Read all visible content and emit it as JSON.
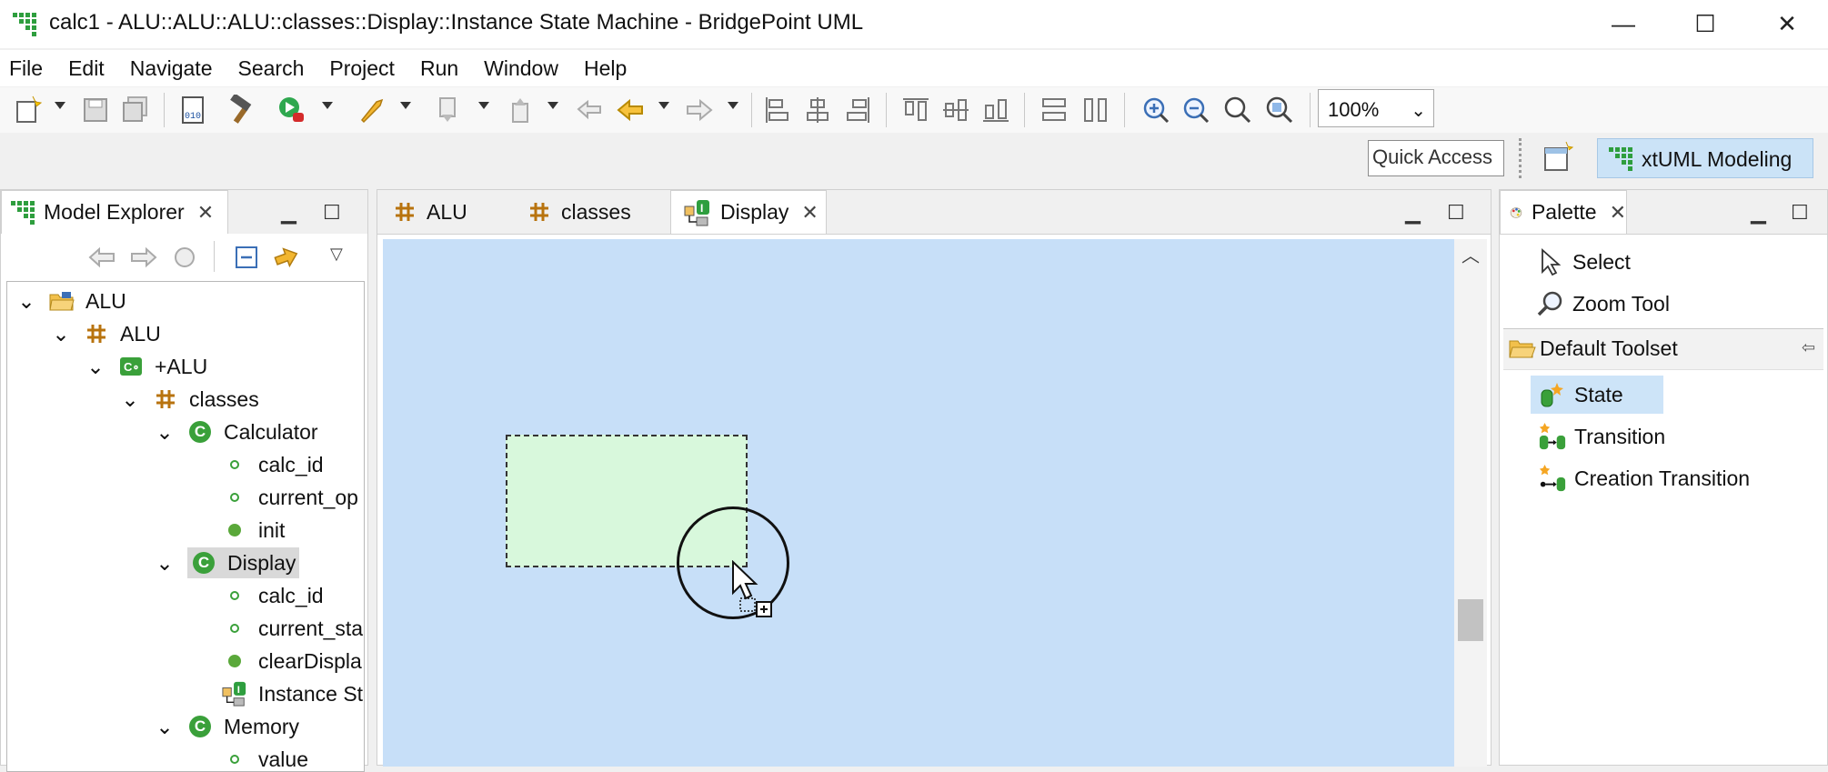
{
  "window": {
    "title": "calc1 - ALU::ALU::ALU::classes::Display::Instance State Machine - BridgePoint UML",
    "minimize": "—",
    "maximize": "☐",
    "close": "✕"
  },
  "menu": [
    "File",
    "Edit",
    "Navigate",
    "Search",
    "Project",
    "Run",
    "Window",
    "Help"
  ],
  "toolbar": {
    "zoom_value": "100%",
    "quick_access": "Quick Access",
    "perspective": "xtUML Modeling"
  },
  "explorer": {
    "tab_label": "Model Explorer",
    "tree": [
      {
        "label": "ALU",
        "icon": "project-folder-icon",
        "expanded": true
      },
      {
        "label": "ALU",
        "icon": "package-icon",
        "expanded": true
      },
      {
        "label": "+ALU",
        "icon": "component-icon",
        "expanded": true
      },
      {
        "label": "classes",
        "icon": "package-icon",
        "expanded": true
      },
      {
        "label": "Calculator",
        "icon": "class-icon",
        "expanded": true
      },
      {
        "label": "calc_id",
        "icon": "attribute-icon"
      },
      {
        "label": "current_op",
        "icon": "attribute-icon"
      },
      {
        "label": "init",
        "icon": "operation-icon"
      },
      {
        "label": "Display",
        "icon": "class-icon",
        "expanded": true,
        "selected": true
      },
      {
        "label": "calc_id",
        "icon": "attribute-icon"
      },
      {
        "label": "current_sta",
        "icon": "attribute-icon"
      },
      {
        "label": "clearDispla",
        "icon": "operation-icon"
      },
      {
        "label": "Instance St",
        "icon": "state-machine-icon"
      },
      {
        "label": "Memory",
        "icon": "class-icon",
        "expanded": true
      },
      {
        "label": "value",
        "icon": "attribute-icon"
      }
    ]
  },
  "editor": {
    "tabs": [
      {
        "label": "ALU",
        "icon": "package-icon"
      },
      {
        "label": "classes",
        "icon": "package-icon"
      },
      {
        "label": "Display",
        "icon": "state-machine-icon",
        "active": true
      }
    ]
  },
  "palette": {
    "tab_label": "Palette",
    "tools": [
      "Select",
      "Zoom Tool"
    ],
    "group_label": "Default Toolset",
    "items": [
      "State",
      "Transition",
      "Creation Transition"
    ]
  },
  "colors": {
    "canvas": "#c7dff8",
    "state_ghost": "#d8f8dc",
    "class_badge": "#3aa03a",
    "perspective_active": "#cbe3f7"
  }
}
